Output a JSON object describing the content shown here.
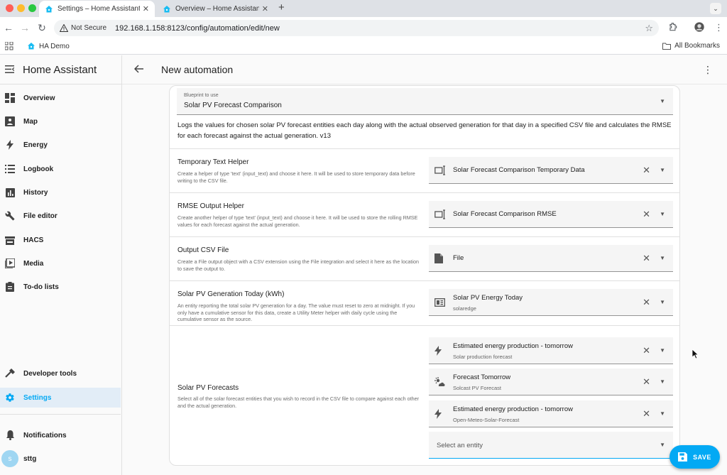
{
  "browser": {
    "tabs": [
      {
        "title": "Settings – Home Assistant",
        "active": true
      },
      {
        "title": "Overview – Home Assistant",
        "active": false
      }
    ],
    "security_label": "Not Secure",
    "url": "192.168.1.158:8123/config/automation/edit/new",
    "bookmarks": {
      "ha_demo": "HA Demo",
      "all": "All Bookmarks"
    }
  },
  "sidebar": {
    "title": "Home Assistant",
    "items": [
      {
        "label": "Overview",
        "icon": "dashboard-icon"
      },
      {
        "label": "Map",
        "icon": "map-icon"
      },
      {
        "label": "Energy",
        "icon": "lightning-icon"
      },
      {
        "label": "Logbook",
        "icon": "list-icon"
      },
      {
        "label": "History",
        "icon": "chart-icon"
      },
      {
        "label": "File editor",
        "icon": "wrench-icon"
      },
      {
        "label": "HACS",
        "icon": "hacs-icon"
      },
      {
        "label": "Media",
        "icon": "play-icon"
      },
      {
        "label": "To-do lists",
        "icon": "clipboard-icon"
      }
    ],
    "developer_tools": "Developer tools",
    "settings": "Settings",
    "notifications": "Notifications",
    "user": {
      "initial": "s",
      "name": "sttg"
    },
    "accent_color": "#03a9f4"
  },
  "header": {
    "title": "New automation"
  },
  "blueprint": {
    "label": "Blueprint to use",
    "value": "Solar PV Forecast Comparison",
    "description": "Logs the values for chosen solar PV forecast entities each day along with the actual observed generation for that day in a specified CSV file and calculates the RMSE for each forecast against the actual generation. v13"
  },
  "fields": [
    {
      "title": "Temporary Text Helper",
      "description": "Create a helper of type 'text' (input_text) and choose it here. It will be used to store temporary data before writing to the CSV file.",
      "selection": {
        "main": "Solar Forecast Comparison Temporary Data",
        "icon": "text-field-icon"
      }
    },
    {
      "title": "RMSE Output Helper",
      "description": "Create another helper of type 'text' (input_text) and choose it here. It will be used to store the rolling RMSE values for each forecast against the actual generation.",
      "selection": {
        "main": "Solar Forecast Comparison RMSE",
        "icon": "text-field-icon"
      }
    },
    {
      "title": "Output CSV File",
      "description": "Create a File output object with a CSV extension using the File integration and select it here as the location to save the output to.",
      "selection": {
        "main": "File",
        "icon": "file-icon"
      }
    },
    {
      "title": "Solar PV Generation Today (kWh)",
      "description": "An entity reporting the total solar PV generation for a day. The value must reset to zero at midnight. If you only have a cumulative sensor for this data, create a Utility Meter helper with daily cycle using the cumulative sensor as the source.",
      "selection": {
        "main": "Solar PV Energy Today",
        "sub": "solaredge",
        "icon": "meter-icon"
      }
    }
  ],
  "forecasts": {
    "title": "Solar PV Forecasts",
    "description": "Select all of the solar forecast entities that you wish to record in the CSV file to compare against each other and the actual generation.",
    "entities": [
      {
        "main": "Estimated energy production - tomorrow",
        "sub": "Solar production forecast",
        "icon": "lightning-icon"
      },
      {
        "main": "Forecast Tomorrow",
        "sub": "Solcast PV Forecast",
        "icon": "weather-partly-cloudy-icon"
      },
      {
        "main": "Estimated energy production - tomorrow",
        "sub": "Open-Meteo-Solar-Forecast",
        "icon": "lightning-icon"
      }
    ],
    "placeholder": "Select an entity"
  },
  "save_label": "SAVE"
}
